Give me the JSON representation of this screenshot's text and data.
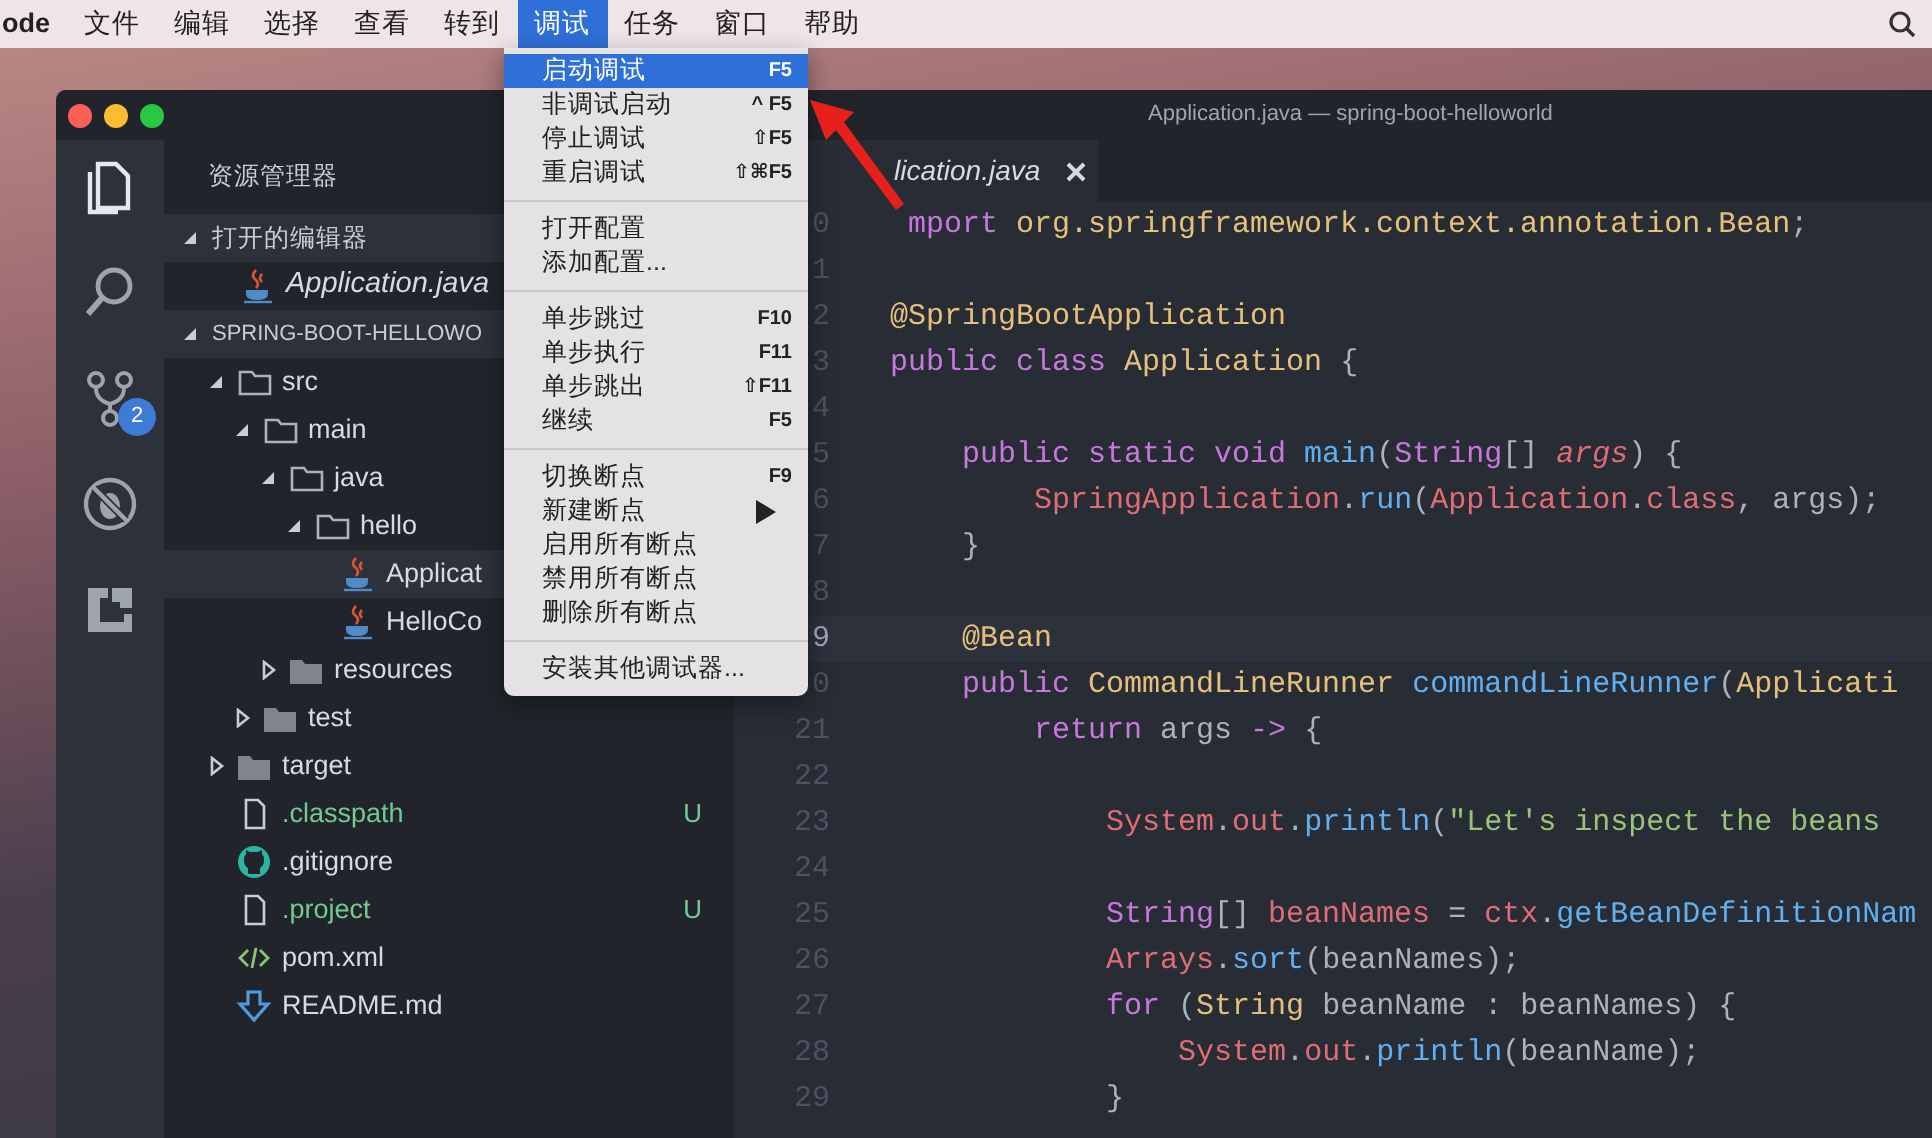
{
  "menubar": {
    "items": [
      {
        "label": "ode",
        "selected": false
      },
      {
        "label": "文件",
        "selected": false
      },
      {
        "label": "编辑",
        "selected": false
      },
      {
        "label": "选择",
        "selected": false
      },
      {
        "label": "查看",
        "selected": false
      },
      {
        "label": "转到",
        "selected": false
      },
      {
        "label": "调试",
        "selected": true
      },
      {
        "label": "任务",
        "selected": false
      },
      {
        "label": "窗口",
        "selected": false
      },
      {
        "label": "帮助",
        "selected": false
      }
    ]
  },
  "debug_menu": {
    "groups": [
      {
        "items": [
          {
            "label": "启动调试",
            "shortcut": "F5",
            "selected": true,
            "submenu": false
          },
          {
            "label": "非调试启动",
            "shortcut": "^ F5",
            "selected": false,
            "submenu": false
          },
          {
            "label": "停止调试",
            "shortcut": "⇧F5",
            "selected": false,
            "submenu": false
          },
          {
            "label": "重启调试",
            "shortcut": "⇧⌘F5",
            "selected": false,
            "submenu": false
          }
        ]
      },
      {
        "items": [
          {
            "label": "打开配置",
            "selected": false,
            "submenu": false
          },
          {
            "label": "添加配置...",
            "selected": false,
            "submenu": false
          }
        ]
      },
      {
        "items": [
          {
            "label": "单步跳过",
            "shortcut": "F10",
            "selected": false,
            "submenu": false
          },
          {
            "label": "单步执行",
            "shortcut": "F11",
            "selected": false,
            "submenu": false
          },
          {
            "label": "单步跳出",
            "shortcut": "⇧F11",
            "selected": false,
            "submenu": false
          },
          {
            "label": "继续",
            "shortcut": "F5",
            "selected": false,
            "submenu": false
          }
        ]
      },
      {
        "items": [
          {
            "label": "切换断点",
            "shortcut": "F9",
            "selected": false,
            "submenu": false
          },
          {
            "label": "新建断点",
            "selected": false,
            "submenu": true
          },
          {
            "label": "启用所有断点",
            "selected": false,
            "submenu": false
          },
          {
            "label": "禁用所有断点",
            "selected": false,
            "submenu": false
          },
          {
            "label": "删除所有断点",
            "selected": false,
            "submenu": false
          }
        ]
      },
      {
        "items": [
          {
            "label": "安装其他调试器...",
            "selected": false,
            "submenu": false
          }
        ]
      }
    ]
  },
  "window": {
    "title": "Application.java — spring-boot-helloworld"
  },
  "activity_bar": [
    {
      "kind": "explorer",
      "selected": true
    },
    {
      "kind": "search",
      "selected": false
    },
    {
      "kind": "git",
      "selected": false,
      "badge": "2"
    },
    {
      "kind": "debug",
      "selected": false
    },
    {
      "kind": "extensions",
      "selected": false
    }
  ],
  "sidebar": {
    "title": "资源管理器",
    "open_editors": {
      "label": "打开的编辑器",
      "expanded": true,
      "items": [
        {
          "name": "Application.java",
          "kind": "java"
        }
      ]
    },
    "project": {
      "label": "SPRING-BOOT-HELLOWO",
      "expanded": true,
      "tree": [
        {
          "name": "src",
          "kind": "folder",
          "expanded": true,
          "selected": false,
          "children": [
            {
              "name": "main",
              "kind": "folder",
              "expanded": true,
              "selected": false,
              "children": [
                {
                  "name": "java",
                  "kind": "folder",
                  "expanded": true,
                  "selected": false,
                  "children": [
                    {
                      "name": "hello",
                      "kind": "folder",
                      "expanded": true,
                      "selected": false,
                      "children": [
                        {
                          "name": "Applicat",
                          "kind": "java",
                          "selected": true
                        },
                        {
                          "name": "HelloCo",
                          "kind": "java",
                          "selected": false
                        }
                      ]
                    }
                  ]
                },
                {
                  "name": "resources",
                  "kind": "folder",
                  "expanded": false,
                  "selected": false
                }
              ]
            },
            {
              "name": "test",
              "kind": "folder",
              "expanded": false,
              "selected": false
            }
          ]
        },
        {
          "name": "target",
          "kind": "folder",
          "expanded": false,
          "selected": false
        },
        {
          "name": ".classpath",
          "kind": "file",
          "selected": false,
          "status": "U"
        },
        {
          "name": ".gitignore",
          "kind": "github",
          "selected": false
        },
        {
          "name": ".project",
          "kind": "file",
          "selected": false,
          "status": "U"
        },
        {
          "name": "pom.xml",
          "kind": "xml",
          "selected": false
        },
        {
          "name": "README.md",
          "kind": "markdown",
          "selected": false
        }
      ]
    }
  },
  "editor": {
    "tab": {
      "label": "lication.java"
    },
    "lines": [
      {
        "number": "0",
        "current": false,
        "tokens": [
          {
            "kind": "keyword",
            "text": " mport"
          },
          {
            "kind": "type",
            "text": " org.springframework.context.annotation.Bean"
          },
          {
            "kind": "plain",
            "text": ";"
          }
        ]
      },
      {
        "number": "1",
        "current": false
      },
      {
        "number": "2",
        "current": false,
        "tokens": [
          {
            "kind": "type",
            "text": "@SpringBootApplication"
          }
        ]
      },
      {
        "number": "3",
        "current": false,
        "tokens": [
          {
            "kind": "keyword",
            "text": "public class "
          },
          {
            "kind": "type",
            "text": "Application"
          },
          {
            "kind": "plain",
            "text": " {"
          }
        ]
      },
      {
        "number": "4",
        "current": false
      },
      {
        "number": "5",
        "current": false,
        "tokens": [
          {
            "kind": "keyword",
            "text": "    public static void "
          },
          {
            "kind": "function",
            "text": "main"
          },
          {
            "kind": "plain",
            "text": "("
          },
          {
            "kind": "keyword",
            "text": "String"
          },
          {
            "kind": "plain",
            "text": "[] "
          },
          {
            "kind": "param",
            "text": "args"
          },
          {
            "kind": "plain",
            "text": ") {"
          }
        ]
      },
      {
        "number": "6",
        "current": false,
        "tokens": [
          {
            "kind": "variable",
            "text": "        SpringApplication"
          },
          {
            "kind": "plain",
            "text": "."
          },
          {
            "kind": "function",
            "text": "run"
          },
          {
            "kind": "plain",
            "text": "("
          },
          {
            "kind": "variable",
            "text": "Application"
          },
          {
            "kind": "plain",
            "text": "."
          },
          {
            "kind": "variable",
            "text": "class"
          },
          {
            "kind": "plain",
            "text": ", args);"
          }
        ]
      },
      {
        "number": "7",
        "current": false,
        "tokens": [
          {
            "kind": "plain",
            "text": "    }"
          }
        ]
      },
      {
        "number": "8",
        "current": false
      },
      {
        "number": "9",
        "current": true,
        "tokens": [
          {
            "kind": "type",
            "text": "    @Bean"
          }
        ]
      },
      {
        "number": "0",
        "current": false,
        "tokens": [
          {
            "kind": "keyword",
            "text": "    public "
          },
          {
            "kind": "type",
            "text": "CommandLineRunner"
          },
          {
            "kind": "function",
            "text": " commandLineRunner"
          },
          {
            "kind": "plain",
            "text": "("
          },
          {
            "kind": "type",
            "text": "Applicati"
          }
        ]
      },
      {
        "number": "21",
        "current": false,
        "tokens": [
          {
            "kind": "keyword",
            "text": "        return"
          },
          {
            "kind": "plain",
            "text": " args "
          },
          {
            "kind": "keyword",
            "text": "->"
          },
          {
            "kind": "plain",
            "text": " {"
          }
        ]
      },
      {
        "number": "22",
        "current": false
      },
      {
        "number": "23",
        "current": false,
        "tokens": [
          {
            "kind": "variable",
            "text": "            System"
          },
          {
            "kind": "plain",
            "text": "."
          },
          {
            "kind": "variable",
            "text": "out"
          },
          {
            "kind": "plain",
            "text": "."
          },
          {
            "kind": "function",
            "text": "println"
          },
          {
            "kind": "plain",
            "text": "("
          },
          {
            "kind": "string",
            "text": "\"Let's inspect the beans"
          }
        ]
      },
      {
        "number": "24",
        "current": false
      },
      {
        "number": "25",
        "current": false,
        "tokens": [
          {
            "kind": "keyword",
            "text": "            String"
          },
          {
            "kind": "plain",
            "text": "[] "
          },
          {
            "kind": "variable",
            "text": "beanNames"
          },
          {
            "kind": "plain",
            "text": " = "
          },
          {
            "kind": "variable",
            "text": "ctx"
          },
          {
            "kind": "plain",
            "text": "."
          },
          {
            "kind": "function",
            "text": "getBeanDefinitionNam"
          }
        ]
      },
      {
        "number": "26",
        "current": false,
        "tokens": [
          {
            "kind": "variable",
            "text": "            Arrays"
          },
          {
            "kind": "plain",
            "text": "."
          },
          {
            "kind": "function",
            "text": "sort"
          },
          {
            "kind": "plain",
            "text": "(beanNames);"
          }
        ]
      },
      {
        "number": "27",
        "current": false,
        "tokens": [
          {
            "kind": "keyword",
            "text": "            for"
          },
          {
            "kind": "plain",
            "text": " ("
          },
          {
            "kind": "type",
            "text": "String"
          },
          {
            "kind": "plain",
            "text": " beanName : beanNames) {"
          }
        ]
      },
      {
        "number": "28",
        "current": false,
        "tokens": [
          {
            "kind": "variable",
            "text": "                System"
          },
          {
            "kind": "plain",
            "text": "."
          },
          {
            "kind": "variable",
            "text": "out"
          },
          {
            "kind": "plain",
            "text": "."
          },
          {
            "kind": "function",
            "text": "println"
          },
          {
            "kind": "plain",
            "text": "(beanName);"
          }
        ]
      },
      {
        "number": "29",
        "current": false,
        "tokens": [
          {
            "kind": "plain",
            "text": "            }"
          }
        ]
      }
    ]
  }
}
